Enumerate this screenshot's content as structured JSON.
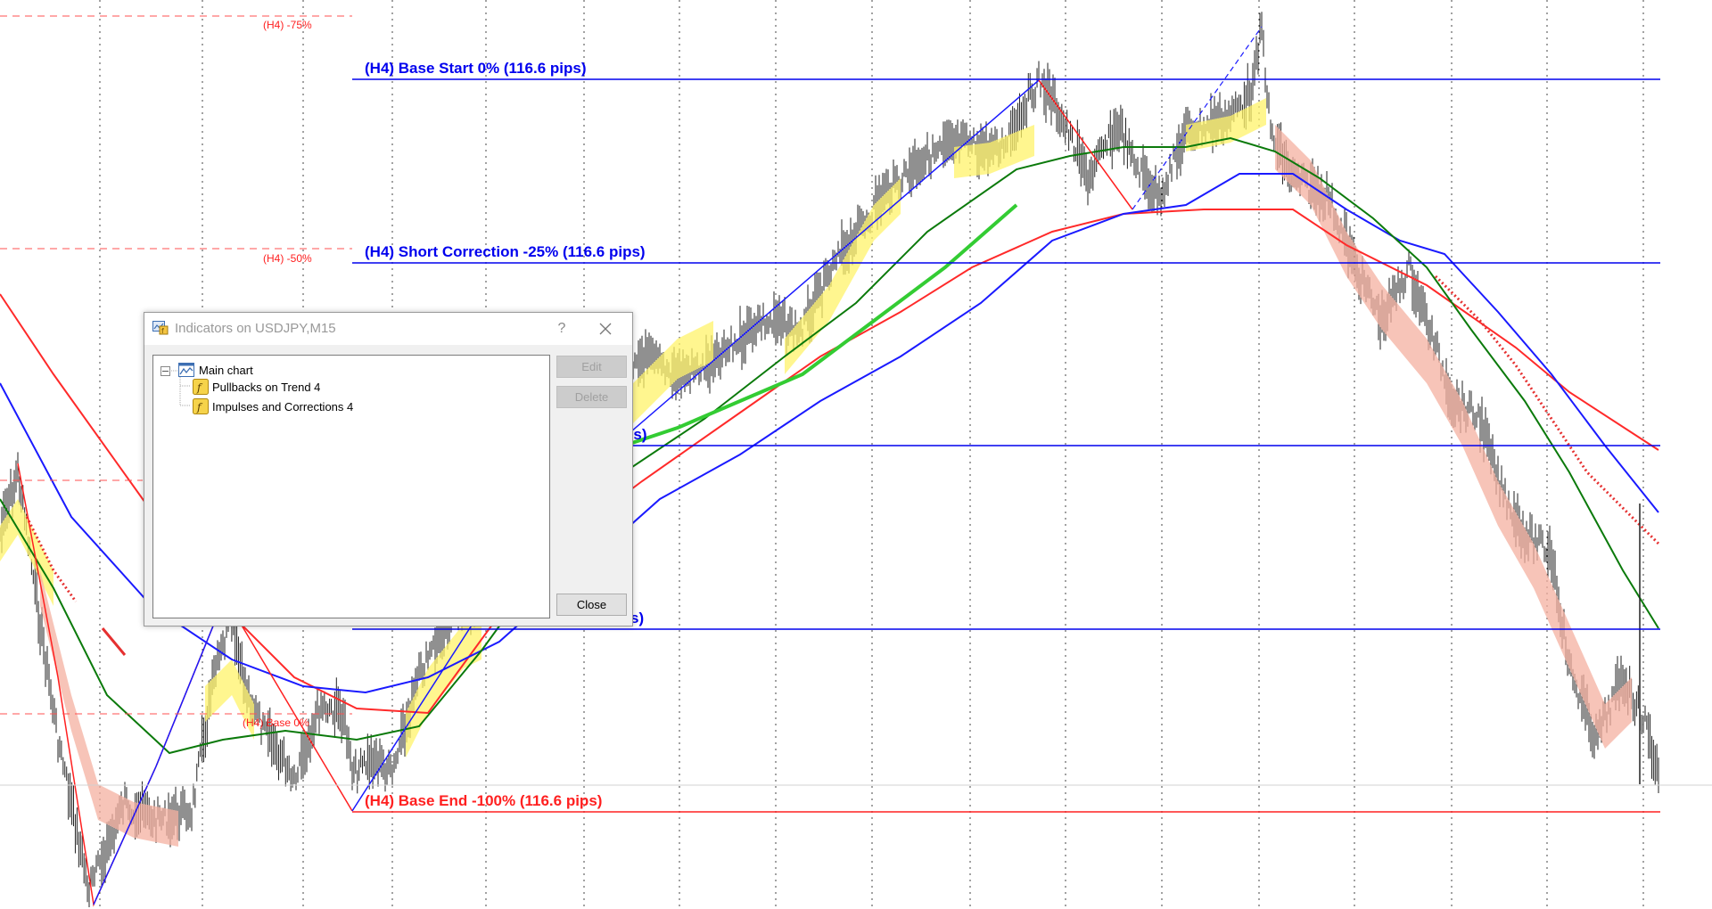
{
  "chart": {
    "levels": {
      "base_start": "(H4) Base Start 0% (116.6 pips)",
      "short_correction": "(H4) Short Correction -25% (116.6 pips)",
      "level_50_partial": "ps)",
      "level_75_partial": "s)",
      "base_end": "(H4) Base End -100% (116.6 pips)"
    },
    "minor_labels": {
      "h4_neg75": "(H4) -75%",
      "h4_neg50": "(H4) -50%",
      "h4_base": "(H4) Base 0%"
    },
    "colors": {
      "blue_level": "#0000ee",
      "red_level": "#ff2020",
      "grid": "#444444"
    }
  },
  "dialog": {
    "title": "Indicators on USDJPY,M15",
    "help": "?",
    "tree": {
      "root": "Main chart",
      "items": [
        "Pullbacks on Trend 4",
        "Impulses and Corrections 4"
      ]
    },
    "buttons": {
      "edit": "Edit",
      "delete": "Delete",
      "close": "Close"
    }
  }
}
